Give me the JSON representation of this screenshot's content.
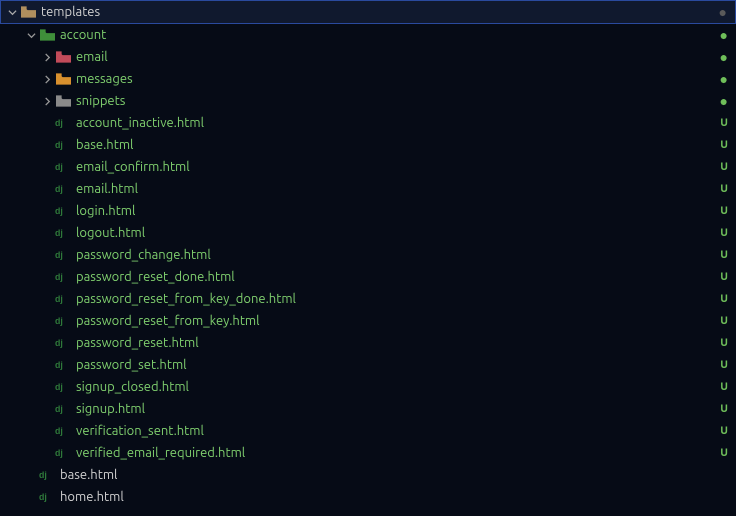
{
  "root": {
    "label": "templates",
    "status_kind": "dot-dim",
    "status": "●"
  },
  "items": [
    {
      "depth": 1,
      "chev": "down",
      "icon": "folder-green",
      "label": "account",
      "cls": "green",
      "status": "●",
      "status_kind": "dot-green"
    },
    {
      "depth": 2,
      "chev": "right",
      "icon": "folder-red",
      "label": "email",
      "cls": "green",
      "status": "●",
      "status_kind": "dot-green"
    },
    {
      "depth": 2,
      "chev": "right",
      "icon": "folder-orange",
      "label": "messages",
      "cls": "green",
      "status": "●",
      "status_kind": "dot-green"
    },
    {
      "depth": 2,
      "chev": "right",
      "icon": "folder-grey",
      "label": "snippets",
      "cls": "green",
      "status": "●",
      "status_kind": "dot-green"
    },
    {
      "depth": 2,
      "chev": "none",
      "icon": "dj",
      "label": "account_inactive.html",
      "cls": "green",
      "status": "U",
      "status_kind": "u"
    },
    {
      "depth": 2,
      "chev": "none",
      "icon": "dj",
      "label": "base.html",
      "cls": "green",
      "status": "U",
      "status_kind": "u"
    },
    {
      "depth": 2,
      "chev": "none",
      "icon": "dj",
      "label": "email_confirm.html",
      "cls": "green",
      "status": "U",
      "status_kind": "u"
    },
    {
      "depth": 2,
      "chev": "none",
      "icon": "dj",
      "label": "email.html",
      "cls": "green",
      "status": "U",
      "status_kind": "u"
    },
    {
      "depth": 2,
      "chev": "none",
      "icon": "dj",
      "label": "login.html",
      "cls": "green",
      "status": "U",
      "status_kind": "u"
    },
    {
      "depth": 2,
      "chev": "none",
      "icon": "dj",
      "label": "logout.html",
      "cls": "green",
      "status": "U",
      "status_kind": "u"
    },
    {
      "depth": 2,
      "chev": "none",
      "icon": "dj",
      "label": "password_change.html",
      "cls": "green",
      "status": "U",
      "status_kind": "u"
    },
    {
      "depth": 2,
      "chev": "none",
      "icon": "dj",
      "label": "password_reset_done.html",
      "cls": "green",
      "status": "U",
      "status_kind": "u"
    },
    {
      "depth": 2,
      "chev": "none",
      "icon": "dj",
      "label": "password_reset_from_key_done.html",
      "cls": "green",
      "status": "U",
      "status_kind": "u"
    },
    {
      "depth": 2,
      "chev": "none",
      "icon": "dj",
      "label": "password_reset_from_key.html",
      "cls": "green",
      "status": "U",
      "status_kind": "u"
    },
    {
      "depth": 2,
      "chev": "none",
      "icon": "dj",
      "label": "password_reset.html",
      "cls": "green",
      "status": "U",
      "status_kind": "u"
    },
    {
      "depth": 2,
      "chev": "none",
      "icon": "dj",
      "label": "password_set.html",
      "cls": "green",
      "status": "U",
      "status_kind": "u"
    },
    {
      "depth": 2,
      "chev": "none",
      "icon": "dj",
      "label": "signup_closed.html",
      "cls": "green",
      "status": "U",
      "status_kind": "u"
    },
    {
      "depth": 2,
      "chev": "none",
      "icon": "dj",
      "label": "signup.html",
      "cls": "green",
      "status": "U",
      "status_kind": "u"
    },
    {
      "depth": 2,
      "chev": "none",
      "icon": "dj",
      "label": "verification_sent.html",
      "cls": "green",
      "status": "U",
      "status_kind": "u"
    },
    {
      "depth": 2,
      "chev": "none",
      "icon": "dj",
      "label": "verified_email_required.html",
      "cls": "green",
      "status": "U",
      "status_kind": "u"
    },
    {
      "depth": 1,
      "chev": "none",
      "icon": "dj",
      "label": "base.html",
      "cls": "white",
      "status": "",
      "status_kind": ""
    },
    {
      "depth": 1,
      "chev": "none",
      "icon": "dj",
      "label": "home.html",
      "cls": "white",
      "status": "",
      "status_kind": ""
    }
  ]
}
